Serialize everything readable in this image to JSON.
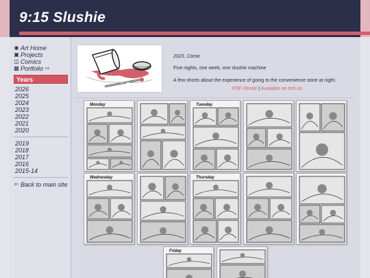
{
  "site": {
    "title": "9:15 Slushie",
    "colors": {
      "header_bg": "#2b2f4a",
      "accent": "#d0606b",
      "page_bg": "#e4e4ec"
    }
  },
  "sidebar": {
    "nav": [
      {
        "label": "Art Home",
        "icon": "palette-icon"
      },
      {
        "label": "Projects",
        "icon": "floppy-icon"
      },
      {
        "label": "Comics",
        "icon": "book-icon"
      },
      {
        "label": "Portfolio",
        "icon": "portfolio-icon"
      }
    ],
    "years_header": "Years",
    "years_group_1": [
      "2026",
      "2025",
      "2024",
      "2023",
      "2022",
      "2021",
      "2020"
    ],
    "years_group_2": [
      "2019",
      "2018",
      "2017",
      "2016",
      "2015-14"
    ],
    "back_label": "Back to main site"
  },
  "project": {
    "meta": "2023, Comic",
    "tagline": "Five nights, one week, one slushie machine",
    "description": "A few shorts about the experience of going to the convenience store at night.",
    "link_pdf": "PDF Onsite",
    "link_separator": "|",
    "link_itch": "Available on Itch.io!"
  },
  "pages": [
    {
      "label": "Monday"
    },
    {
      "label": ""
    },
    {
      "label": "Tuesday"
    },
    {
      "label": ""
    },
    {
      "label": ""
    },
    {
      "label": "Wednesday"
    },
    {
      "label": ""
    },
    {
      "label": "Thursday"
    },
    {
      "label": ""
    },
    {
      "label": ""
    },
    {
      "label": "Friday"
    },
    {
      "label": ""
    }
  ]
}
